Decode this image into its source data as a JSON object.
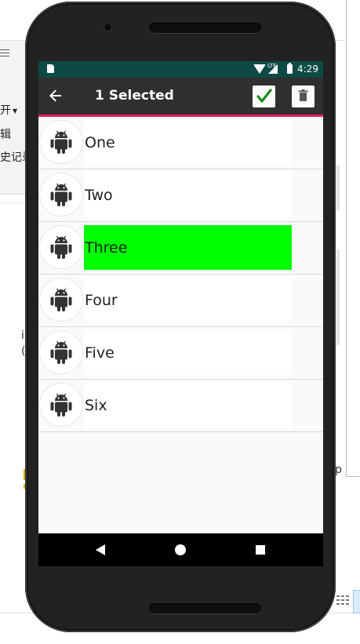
{
  "background_app": {
    "menu_items": [
      "开",
      "辑",
      "史记录"
    ],
    "fragments": [
      "i",
      "(",
      "p"
    ]
  },
  "status_bar": {
    "network": "LTE",
    "time": "4:29"
  },
  "app_bar": {
    "title": "1 Selected",
    "accent_color": "#e91e63",
    "background_color": "#2f2f2f"
  },
  "list": {
    "items": [
      {
        "label": "One",
        "selected": false
      },
      {
        "label": "Two",
        "selected": false
      },
      {
        "label": "Three",
        "selected": true
      },
      {
        "label": "Four",
        "selected": false
      },
      {
        "label": "Five",
        "selected": false
      },
      {
        "label": "Six",
        "selected": false
      }
    ],
    "selected_color": "#00ff00"
  },
  "icons": {
    "back": "arrow-back-icon",
    "confirm": "checkmark-icon",
    "delete": "trash-icon",
    "item_avatar": "android-robot-icon"
  }
}
